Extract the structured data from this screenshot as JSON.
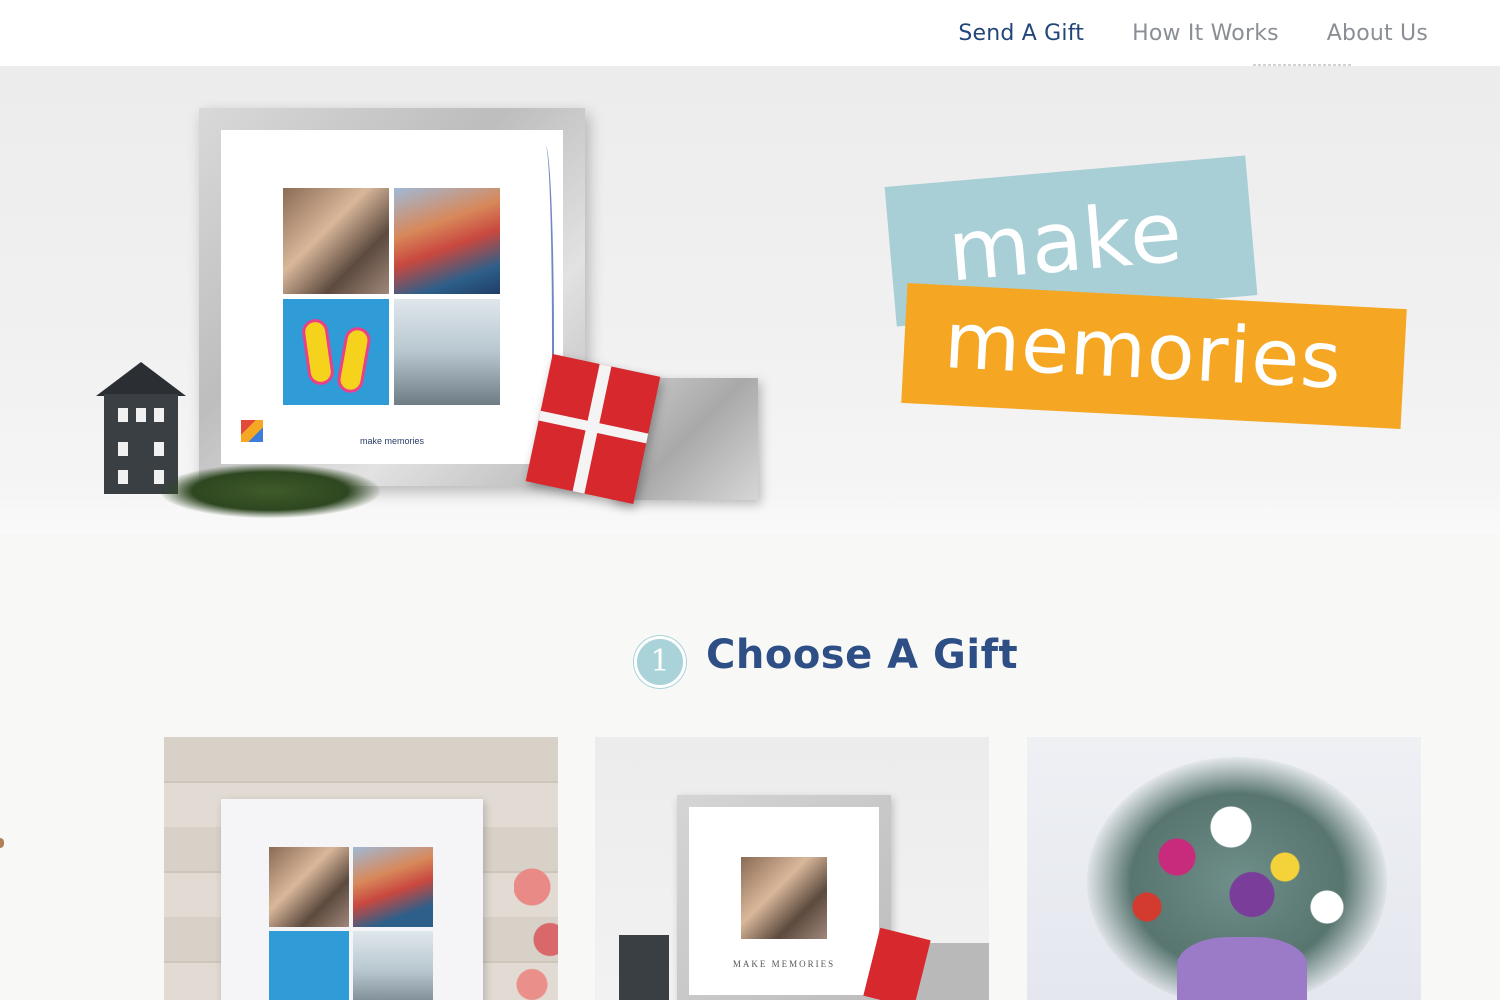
{
  "nav": {
    "items": [
      {
        "label": "Send A Gift",
        "active": true
      },
      {
        "label": "How It Works",
        "active": false
      },
      {
        "label": "About Us",
        "active": false
      }
    ]
  },
  "hero": {
    "tagline_line1": "make",
    "tagline_line2": "memories",
    "frame_caption": "make memories",
    "tag_colors": {
      "make": "#a8cfd6",
      "memories": "#f5a623"
    }
  },
  "section": {
    "step_number": "1",
    "title": "Choose A Gift"
  },
  "gifts": [
    {
      "name": "photo-print"
    },
    {
      "name": "framed-photo",
      "caption": "MAKE MEMORIES"
    },
    {
      "name": "flower-bouquet"
    }
  ],
  "colors": {
    "nav_active": "#23467a",
    "nav_inactive": "#8a8f96",
    "heading": "#2e4f86",
    "step_circle": "#a9d3d9"
  }
}
